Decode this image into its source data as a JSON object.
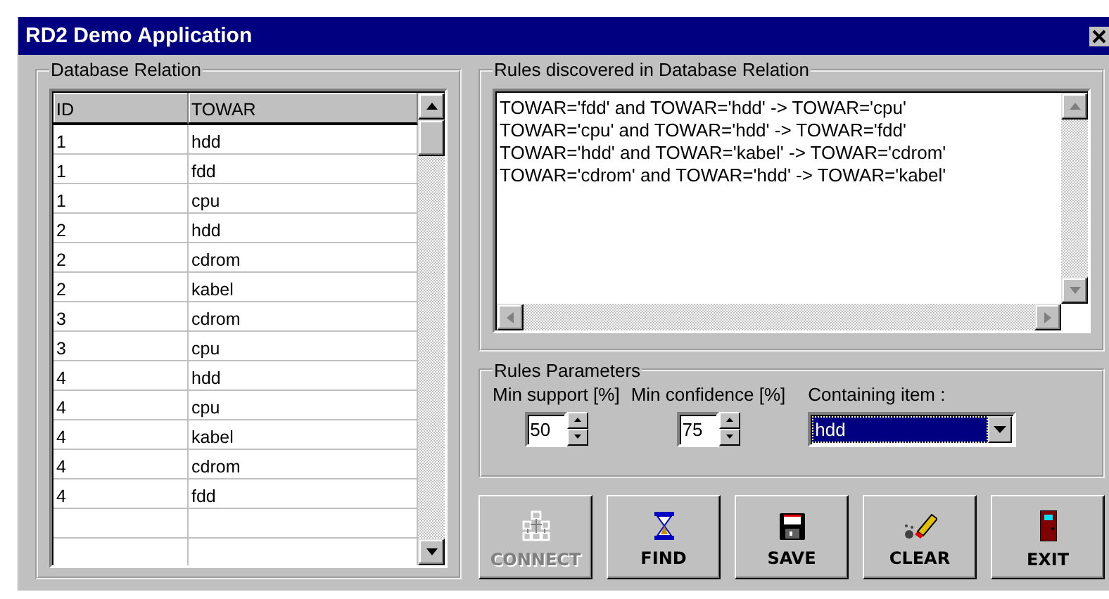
{
  "window": {
    "title": "RD2 Demo Application"
  },
  "database_relation": {
    "title": "Database Relation",
    "columns": [
      "ID",
      "TOWAR"
    ],
    "rows": [
      [
        "1",
        "hdd"
      ],
      [
        "1",
        "fdd"
      ],
      [
        "1",
        "cpu"
      ],
      [
        "2",
        "hdd"
      ],
      [
        "2",
        "cdrom"
      ],
      [
        "2",
        "kabel"
      ],
      [
        "3",
        "cdrom"
      ],
      [
        "3",
        "cpu"
      ],
      [
        "4",
        "hdd"
      ],
      [
        "4",
        "cpu"
      ],
      [
        "4",
        "kabel"
      ],
      [
        "4",
        "cdrom"
      ],
      [
        "4",
        "fdd"
      ]
    ]
  },
  "rules": {
    "title": "Rules discovered in Database Relation",
    "lines": [
      "TOWAR='fdd' and TOWAR='hdd' -> TOWAR='cpu'",
      "TOWAR='cpu' and TOWAR='hdd' -> TOWAR='fdd'",
      "TOWAR='hdd' and TOWAR='kabel' -> TOWAR='cdrom'",
      "TOWAR='cdrom' and TOWAR='hdd' -> TOWAR='kabel'"
    ]
  },
  "parameters": {
    "title": "Rules Parameters",
    "min_support": {
      "label": "Min support [%]",
      "value": "50"
    },
    "min_confidence": {
      "label": "Min confidence [%]",
      "value": "75"
    },
    "containing_item": {
      "label": "Containing item :",
      "value": "hdd",
      "selected": true
    }
  },
  "buttons": [
    {
      "label": "CONNECT",
      "kind": "connect",
      "disabled": true
    },
    {
      "label": "FIND",
      "kind": "find",
      "disabled": false
    },
    {
      "label": "SAVE",
      "kind": "save",
      "disabled": false
    },
    {
      "label": "CLEAR",
      "kind": "clear",
      "disabled": false
    },
    {
      "label": "EXIT",
      "kind": "exit",
      "disabled": false
    }
  ]
}
